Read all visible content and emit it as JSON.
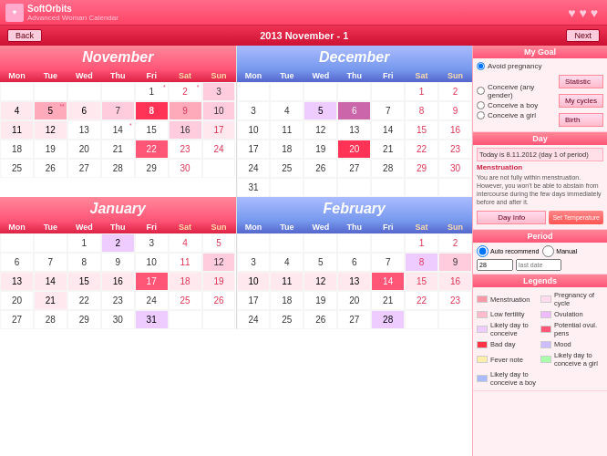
{
  "app": {
    "name": "SoftOrbits",
    "subtitle": "Advanced Woman Calendar"
  },
  "nav": {
    "back": "Back",
    "title": "2013 November - 1",
    "next": "Next"
  },
  "months": [
    {
      "name": "November",
      "color": "pink",
      "days_header": [
        "Mon",
        "Tue",
        "Wed",
        "Thu",
        "Fri",
        "Sat",
        "Sun"
      ],
      "weeks": [
        [
          "",
          "",
          "",
          "",
          "1",
          "2",
          "3"
        ],
        [
          "4",
          "5",
          "6",
          "7",
          "8",
          "9",
          "10"
        ],
        [
          "11",
          "12",
          "13",
          "14",
          "15",
          "16",
          "17"
        ],
        [
          "18",
          "19",
          "20",
          "21",
          "22",
          "23",
          "24"
        ],
        [
          "25",
          "26",
          "27",
          "28",
          "29",
          "30",
          ""
        ]
      ],
      "cell_styles": {
        "1-5": "normal",
        "1-6": "weekend-day",
        "1-7": "weekend-day pink-bg",
        "2-1": "pink-bg",
        "2-2": "pink-bg dot2",
        "2-3": "pink-bg",
        "2-4": "today-cell",
        "2-5": "pink-bg",
        "2-6": "weekend-day pink-bg",
        "2-7": "weekend-day pink-bg",
        "3-1": "light-pink",
        "3-2": "light-pink",
        "3-3": "light-pink",
        "3-4": "light-pink",
        "3-5": "light-pink",
        "3-6": "weekend-day pink-bg",
        "3-7": "weekend-day light-pink",
        "4-1": "normal",
        "4-2": "normal",
        "4-3": "normal",
        "4-4": "dark-pink",
        "4-5": "normal",
        "4-6": "weekend-day",
        "4-7": "weekend-day",
        "5-1": "normal",
        "5-2": "normal",
        "5-3": "normal",
        "5-4": "normal",
        "5-5": "normal",
        "5-6": "weekend-day",
        "5-7": ""
      }
    },
    {
      "name": "December",
      "color": "blue",
      "days_header": [
        "Mon",
        "Tue",
        "Wed",
        "Thu",
        "Fri",
        "Sat",
        "Sun"
      ],
      "weeks": [
        [
          "",
          "",
          "",
          "",
          "",
          "",
          "1"
        ],
        [
          "2",
          "3",
          "4",
          "5",
          "6",
          "7",
          "8"
        ],
        [
          "9",
          "10",
          "11",
          "12",
          "13",
          "14",
          "15"
        ],
        [
          "16",
          "17",
          "18",
          "19",
          "20",
          "21",
          "22"
        ],
        [
          "23",
          "24",
          "25",
          "26",
          "27",
          "28",
          "29"
        ],
        [
          "30",
          "31",
          "",
          "",
          "",
          "",
          ""
        ]
      ]
    },
    {
      "name": "January",
      "color": "pink",
      "days_header": [
        "Mon",
        "Tue",
        "Wed",
        "Thu",
        "Fri",
        "Sat",
        "Sun"
      ],
      "weeks": [
        [
          "",
          "",
          "1",
          "2",
          "3",
          "4",
          "5"
        ],
        [
          "6",
          "7",
          "8",
          "9",
          "10",
          "11",
          "12"
        ],
        [
          "13",
          "14",
          "15",
          "16",
          "17",
          "18",
          "19"
        ],
        [
          "20",
          "21",
          "22",
          "23",
          "24",
          "25",
          "26"
        ],
        [
          "27",
          "28",
          "29",
          "30",
          "31",
          "",
          ""
        ]
      ]
    },
    {
      "name": "February",
      "color": "blue",
      "days_header": [
        "Mon",
        "Tue",
        "Wed",
        "Thu",
        "Fri",
        "Sat",
        "Sun"
      ],
      "weeks": [
        [
          "",
          "",
          "",
          "",
          "",
          "1",
          "2"
        ],
        [
          "3",
          "4",
          "5",
          "6",
          "7",
          "8",
          "9"
        ],
        [
          "10",
          "11",
          "12",
          "13",
          "14",
          "15",
          "16"
        ],
        [
          "17",
          "18",
          "19",
          "20",
          "21",
          "22",
          "23"
        ],
        [
          "24",
          "25",
          "26",
          "27",
          "28",
          "",
          ""
        ]
      ]
    }
  ],
  "sidebar": {
    "my_goal": "My Goal",
    "avoid_pregnancy": "Avoid pregnancy",
    "conceive_any": "Conceive (any gender)",
    "conceive_boy": "Conceive a boy",
    "conceive_girl": "Conceive a girl",
    "statistic": "Statistic",
    "my_cycles": "My cycles",
    "birth": "Birth",
    "day_title": "Day",
    "today_label": "Today is 8.11.2012 (day 1 of period)",
    "menstruation_title": "Menstruation",
    "menstruation_text": "You are not fully within menstruation. However, you won't be able to abstain from intercourse during the few days immediately before and after it.",
    "day_info": "Day Info",
    "temperature": "Temperature",
    "set_temperature": "Set Temperature",
    "period_title": "Period",
    "auto_recommend": "Auto recommend",
    "manual": "Manual",
    "legends_title": "Legends",
    "legend_items": [
      {
        "color": "#ff99aa",
        "label": "Menstruation"
      },
      {
        "color": "#ffddee",
        "label": "Pregnancy of cycle"
      },
      {
        "color": "#ffbbcc",
        "label": "Low fertility"
      },
      {
        "color": "#eebbff",
        "label": "Ovulation"
      },
      {
        "color": "#eeccff",
        "label": "Likely day to conceive"
      },
      {
        "color": "#ff5577",
        "label": "Potential ovulation"
      },
      {
        "color": "#ff3344",
        "label": "Bad day"
      },
      {
        "color": "#ccbbff",
        "label": "Mood"
      },
      {
        "color": "#ffeeaa",
        "label": "Fever note"
      },
      {
        "color": "#aaffaa",
        "label": "Likely day to conceive a girl"
      },
      {
        "color": "#aabbff",
        "label": "Likely day to conceive a boy"
      }
    ]
  }
}
